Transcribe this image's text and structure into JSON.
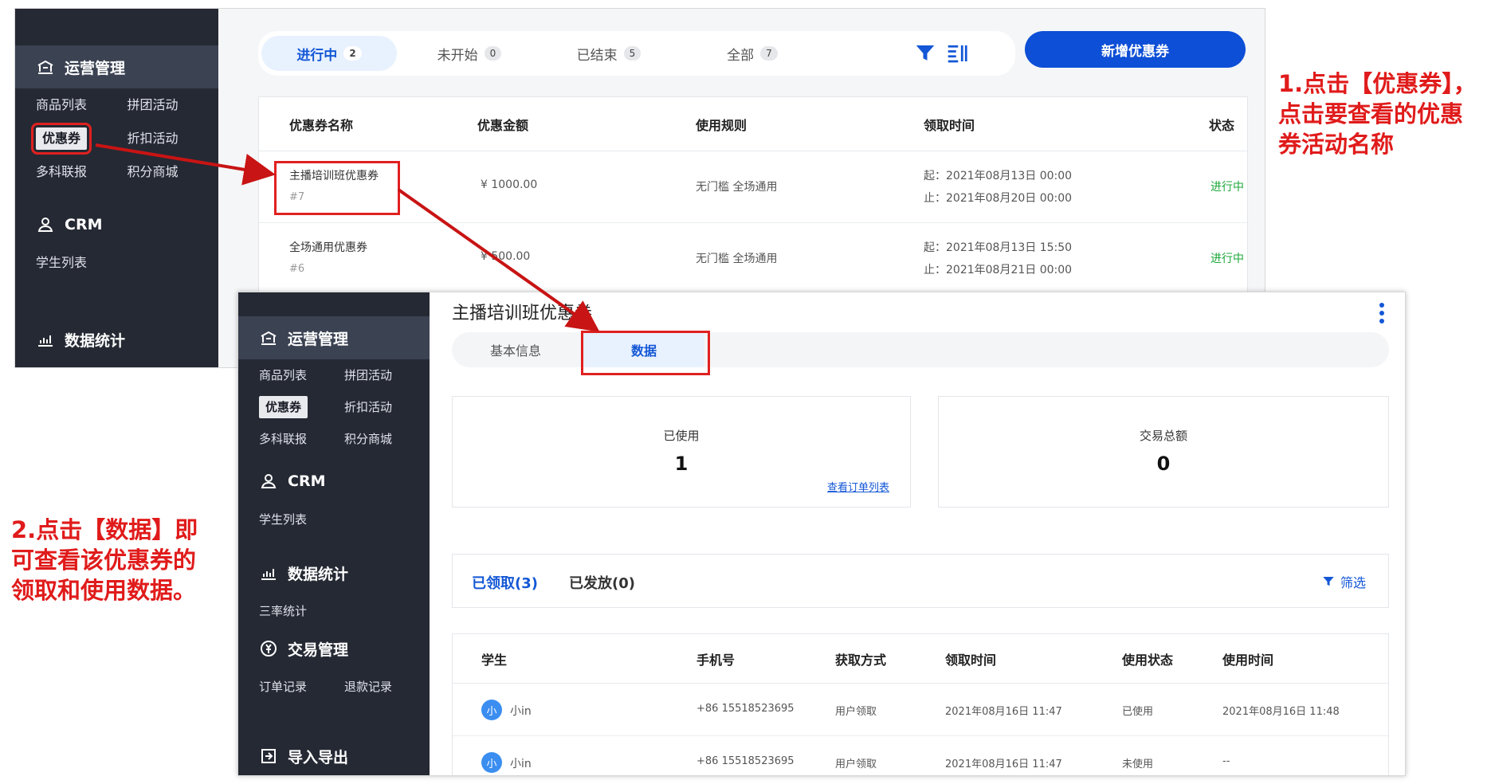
{
  "screen1": {
    "sidebar": {
      "ops_title": "运营管理",
      "ops_items": [
        "商品列表",
        "拼团活动",
        "优惠券",
        "折扣活动",
        "多科联报",
        "积分商城"
      ],
      "crm_title": "CRM",
      "crm_items": [
        "学生列表"
      ],
      "stats_title": "数据统计"
    },
    "tabs": [
      {
        "label": "进行中",
        "count": "2"
      },
      {
        "label": "未开始",
        "count": "0"
      },
      {
        "label": "已结束",
        "count": "5"
      },
      {
        "label": "全部",
        "count": "7"
      }
    ],
    "add_button": "新增优惠券",
    "table": {
      "headers": [
        "优惠券名称",
        "优惠金额",
        "使用规则",
        "领取时间",
        "状态"
      ],
      "rows": [
        {
          "name": "主播培训班优惠券",
          "id": "#7",
          "amount": "¥ 1000.00",
          "rule": "无门槛 全场通用",
          "start": "起：2021年08月13日 00:00",
          "end": "止：2021年08月20日 00:00",
          "status": "进行中"
        },
        {
          "name": "全场通用优惠券",
          "id": "#6",
          "amount": "¥ 500.00",
          "rule": "无门槛 全场通用",
          "start": "起：2021年08月13日 15:50",
          "end": "止：2021年08月21日 00:00",
          "status": "进行中"
        }
      ]
    }
  },
  "screen2": {
    "title": "主播培训班优惠券",
    "sidebar": {
      "ops_title": "运营管理",
      "ops_items": [
        "商品列表",
        "拼团活动",
        "优惠券",
        "折扣活动",
        "多科联报",
        "积分商城"
      ],
      "crm_title": "CRM",
      "crm_items": [
        "学生列表"
      ],
      "stats_title": "数据统计",
      "stats_items": [
        "三率统计"
      ],
      "trade_title": "交易管理",
      "trade_items": [
        "订单记录",
        "退款记录"
      ],
      "io_title": "导入导出"
    },
    "tabs": [
      "基本信息",
      "数据"
    ],
    "stats": [
      {
        "label": "已使用",
        "value": "1",
        "link": "查看订单列表"
      },
      {
        "label": "交易总额",
        "value": "0"
      }
    ],
    "subtabs": [
      "已领取(3)",
      "已发放(0)"
    ],
    "filter_label": "筛选",
    "table": {
      "headers": [
        "学生",
        "手机号",
        "获取方式",
        "领取时间",
        "使用状态",
        "使用时间"
      ],
      "rows": [
        {
          "avatar": "小",
          "name": "小in",
          "phone": "+86 15518523695",
          "method": "用户领取",
          "time": "2021年08月16日 11:47",
          "state": "已使用",
          "used": "2021年08月16日 11:48"
        },
        {
          "avatar": "小",
          "name": "小in",
          "phone": "+86 15518523695",
          "method": "用户领取",
          "time": "2021年08月16日 11:47",
          "state": "未使用",
          "used": "--"
        }
      ]
    }
  },
  "annotations": {
    "step1": [
      "1.点击【优惠券】，",
      "点击要查看的优惠",
      "券活动名称"
    ],
    "step2": [
      "2.点击【数据】即",
      "可查看该优惠券的",
      "领取和使用数据。"
    ]
  },
  "colors": {
    "accent": "#0d4fd6",
    "annotation": "#e02020",
    "sidebar": "#252933",
    "status_green": "#1fa83b"
  }
}
